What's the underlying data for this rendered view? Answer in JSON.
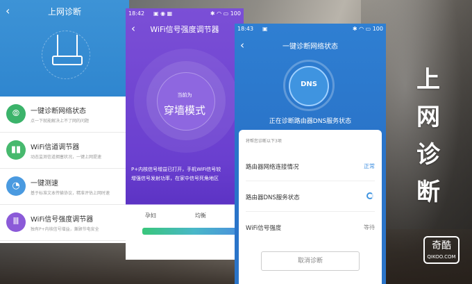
{
  "phone1": {
    "title": "上网诊断",
    "items": [
      {
        "title": "一键诊断网络状态",
        "subtitle": "点一下就能解决上不了网的问题",
        "color": "#3bb36a"
      },
      {
        "title": "WiFi信道调节器",
        "subtitle": "动态监测信道拥塞状况，一键上网提速",
        "color": "#47b96e"
      },
      {
        "title": "一键测速",
        "subtitle": "基于标准文本传输协议，精准评估上网时速",
        "color": "#4a9ae0"
      },
      {
        "title": "WiFi信号强度调节器",
        "subtitle": "独有P+内核信号增益，兼顾节电安全",
        "color": "#8b5ad8"
      }
    ]
  },
  "phone2": {
    "time": "18:42",
    "battery": "100",
    "title": "WiFi信号强度调节器",
    "mode_label": "当前为",
    "mode": "穿墙模式",
    "desc_line1": "P+内核信号增益已打开，手机WiFi信号较",
    "desc_line2": "增强信号发射功率，在家中信号死角地区",
    "level_left": "孕妇",
    "level_mid": "均衡"
  },
  "phone3": {
    "time": "18:43",
    "battery": "100",
    "title": "一键诊断网络状态",
    "dns": "DNS",
    "status": "正在诊断路由器DNS服务状态",
    "hint": "将帮您诊断以下3项",
    "rows": [
      {
        "label": "路由器网络连接情况",
        "value": "正常"
      },
      {
        "label": "路由器DNS服务状态",
        "value": ""
      },
      {
        "label": "WiFi信号强度",
        "value": "等待"
      }
    ],
    "cancel": "取消诊断"
  },
  "side_title": [
    "上",
    "网",
    "诊",
    "断"
  ],
  "logo": {
    "main": "奇酷",
    "sub": "QIKOO.COM"
  }
}
